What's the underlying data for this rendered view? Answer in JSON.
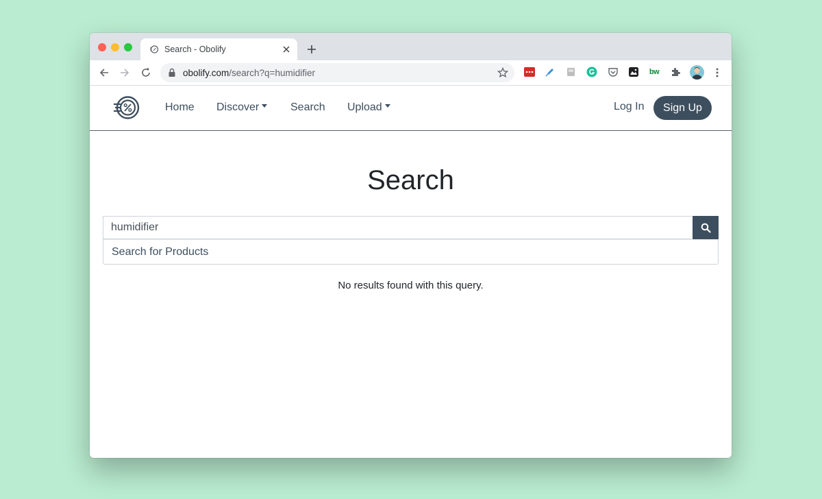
{
  "browser": {
    "tab_title": "Search - Obolify",
    "url_host": "obolify.com",
    "url_path": "/search?q=humidifier",
    "extensions": [
      "lastpass-icon",
      "highlighter-icon",
      "notes-icon",
      "grammarly-icon",
      "pocket-icon",
      "image-icon",
      "bw-icon",
      "puzzle-icon"
    ],
    "ext_bw_label": "bw"
  },
  "navbar": {
    "links": [
      {
        "label": "Home"
      },
      {
        "label": "Discover"
      },
      {
        "label": "Search"
      },
      {
        "label": "Upload"
      }
    ],
    "login_label": "Log In",
    "signup_label": "Sign Up"
  },
  "main": {
    "heading": "Search",
    "search_value": "humidifier",
    "suggestion": "Search for Products",
    "empty_message": "No results found with this query."
  },
  "colors": {
    "brand": "#3d4e5e",
    "background": "#b9ecd0"
  }
}
